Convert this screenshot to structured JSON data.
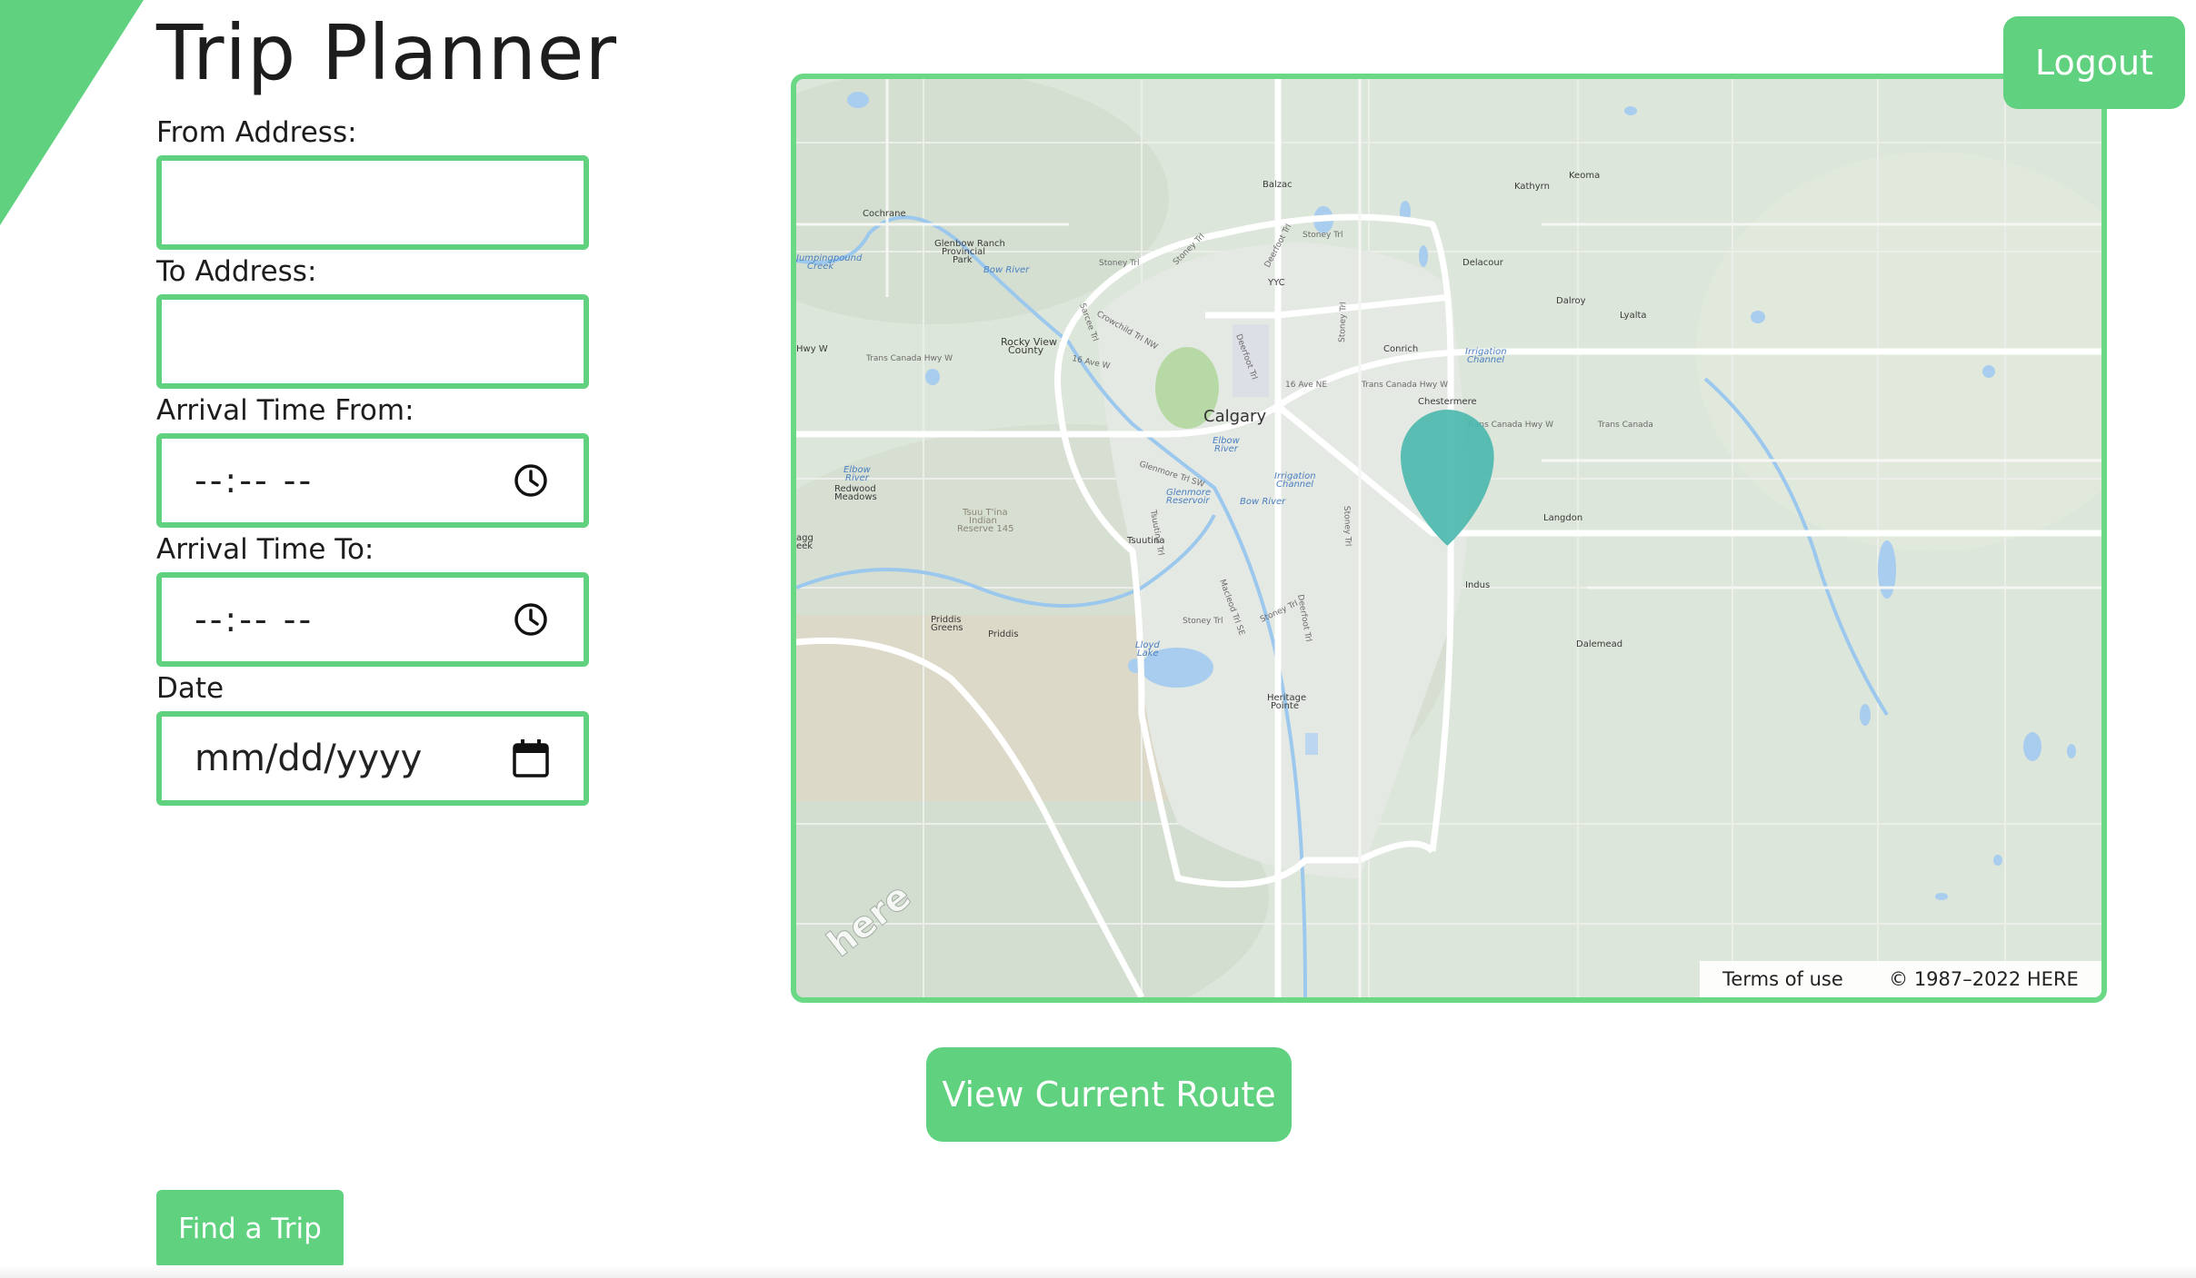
{
  "colors": {
    "accent": "#5fd17f",
    "marker": "#4db8b0"
  },
  "page": {
    "title": "Trip Planner"
  },
  "form": {
    "from_label": "From Address:",
    "from_value": "",
    "to_label": "To Address:",
    "to_value": "",
    "arrival_from_label": "Arrival Time From:",
    "arrival_from_value": "--:-- --",
    "arrival_to_label": "Arrival Time To:",
    "arrival_to_value": "--:-- --",
    "date_label": "Date",
    "date_value": "mm/dd/yyyy"
  },
  "header": {
    "logout_label": "Logout"
  },
  "map": {
    "places": {
      "balzac": "Balzac",
      "kathyrn": "Kathyrn",
      "keoma": "Keoma",
      "cochrane": "Cochrane",
      "glenbow1": "Glenbow Ranch",
      "glenbow2": "Provincial",
      "glenbow3": "Park",
      "jumpingpound1": "Jumpingpound",
      "jumpingpound2": "Creek",
      "bow_river_nw": "Bow River",
      "delacour": "Delacour",
      "dalroy": "Dalroy",
      "lyalta": "Lyalta",
      "yyc": "YYC",
      "rockyview1": "Rocky View",
      "rockyview2": "County",
      "conrich": "Conrich",
      "irrigation_e1": "Irrigation",
      "irrigation_e2": "Channel",
      "chestermere": "Chestermere",
      "calgary": "Calgary",
      "elbow1": "Elbow",
      "elbow2": "River",
      "elbow_w1": "Elbow",
      "elbow_w2": "River",
      "redwood1": "Redwood",
      "redwood2": "Meadows",
      "tsuu1": "Tsuu T'ina",
      "tsuu2": "Indian",
      "tsuu3": "Reserve 145",
      "tsuutina": "Tsuutina",
      "glenmore1": "Glenmore",
      "glenmore2": "Reservoir",
      "irrigation_c1": "Irrigation",
      "irrigation_c2": "Channel",
      "bow_river_c": "Bow River",
      "langdon": "Langdon",
      "indus": "Indus",
      "priddis_greens1": "Priddis",
      "priddis_greens2": "Greens",
      "priddis": "Priddis",
      "lloyd1": "Lloyd",
      "lloyd2": "Lake",
      "dalemead": "Dalemead",
      "heritage1": "Heritage",
      "heritage2": "Pointe",
      "hwy_w": "Hwy W",
      "egg1": "agg",
      "egg2": "eek"
    },
    "roads": {
      "stoney_tr_n": "Stoney Trl",
      "stoney_tr_nw": "Stoney Trl",
      "deerfoot_n": "Deerfoot Trl",
      "stoney_tr_s": "Stoney Trl",
      "crowchild": "Crowchild Trl NW",
      "sarcee": "Sarcee Trl",
      "trans_canada_w": "Trans Canada Hwy W",
      "ave16": "16 Ave W",
      "deerfoot_ne": "Deerfoot Trl",
      "ave16_ne": "16 Ave NE",
      "trans_canada_e": "Trans Canada Hwy W",
      "trans_canada_e2": "Trans Canada Hwy W",
      "trans_canada_far": "Trans Canada",
      "stoney_e": "Stoney Trl",
      "glenmore_tr": "Glenmore Trl SW",
      "tsuutina_tr": "Tsuutina Trl",
      "stoney_e2": "Stoney Trl",
      "macleod": "Macleod Trl SE",
      "stoney_sw": "Stoney Trl",
      "stoney_se": "Stoney Trl",
      "deerfoot_s": "Deerfoot Trl"
    },
    "watermark": "here",
    "terms_label": "Terms of use",
    "copyright": "© 1987–2022 HERE"
  },
  "actions": {
    "view_route_label": "View Current Route",
    "find_trip_label": "Find a Trip"
  }
}
